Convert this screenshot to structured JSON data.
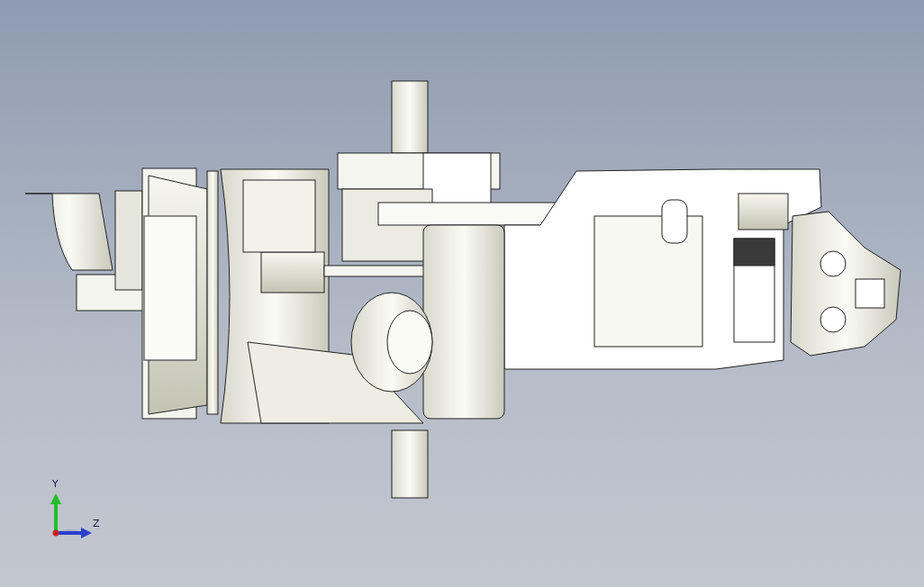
{
  "viewport": {
    "axis_triad": {
      "y_label": "Y",
      "z_label": "Z"
    }
  }
}
